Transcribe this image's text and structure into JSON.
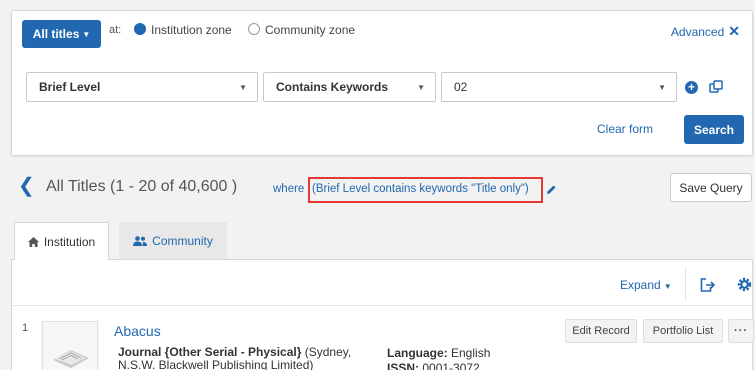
{
  "search": {
    "scope_button": "All titles",
    "at_label": "at:",
    "zones": [
      {
        "label": "Institution zone",
        "selected": true
      },
      {
        "label": "Community zone",
        "selected": false
      }
    ],
    "advanced_label": "Advanced",
    "field_select": "Brief Level",
    "operator_select": "Contains Keywords",
    "value_select": "02",
    "clear_label": "Clear form",
    "search_label": "Search"
  },
  "results": {
    "title": "All Titles (1 - 20 of 40,600 )",
    "where_label": "where",
    "query": "(Brief Level contains keywords \"Title only\")",
    "save_query_label": "Save Query",
    "tabs": [
      {
        "label": "Institution",
        "active": true
      },
      {
        "label": "Community",
        "active": false
      }
    ],
    "expand_label": "Expand",
    "rows": [
      {
        "number": "1",
        "title": "Abacus",
        "type_bold": "Journal {Other Serial - Physical}",
        "type_rest": " (Sydney, N.S.W. Blackwell Publishing Limited)",
        "language_label": "Language:",
        "language_value": " English",
        "issn_label": "ISSN:",
        "issn_value": " 0001-3072",
        "actions": [
          "Edit Record",
          "Portfolio List",
          "···"
        ]
      }
    ]
  },
  "colors": {
    "accent": "#2168b0",
    "highlight_border": "#e53935",
    "page_bg": "#f2f2f2"
  }
}
